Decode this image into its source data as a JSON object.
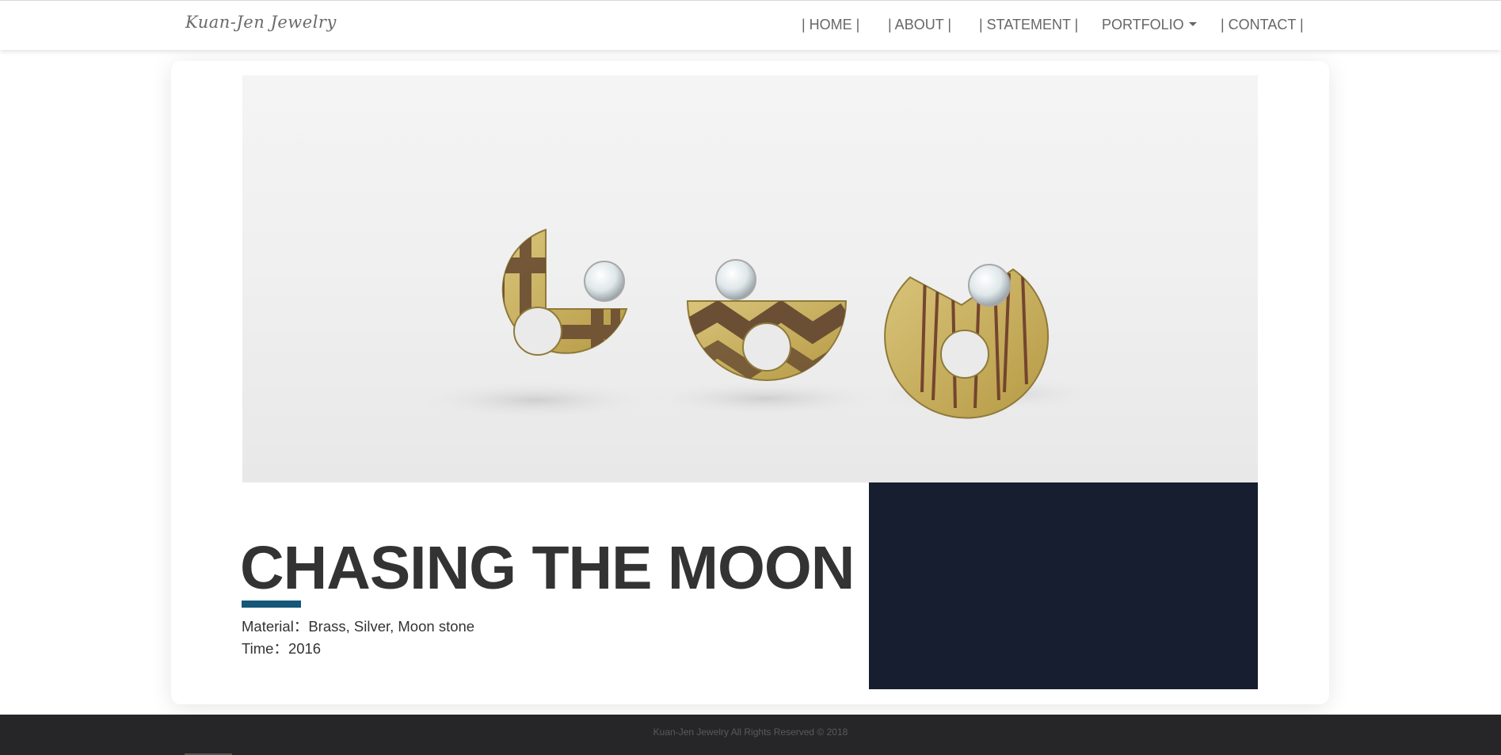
{
  "brand": {
    "name": "Kuan-Jen Jewelry"
  },
  "nav": {
    "items": [
      {
        "label": "| HOME |"
      },
      {
        "label": "| ABOUT |"
      },
      {
        "label": "| STATEMENT |"
      },
      {
        "label": "PORTFOLIO",
        "has_dropdown": true
      },
      {
        "label": "| CONTACT |"
      }
    ]
  },
  "artwork": {
    "title": "CHASING THE MOON",
    "material_label": "Material：",
    "material_value": "Brass, Silver, Moon stone",
    "time_label": "Time：",
    "time_value": "2016"
  },
  "colors": {
    "accent": "#145778",
    "dark_block": "#171e2f",
    "footer_bg": "#262628",
    "text": "#333333"
  },
  "footer": {
    "copyright": "Kuan-Jen Jewelry All Rights Reserved © 2018"
  }
}
